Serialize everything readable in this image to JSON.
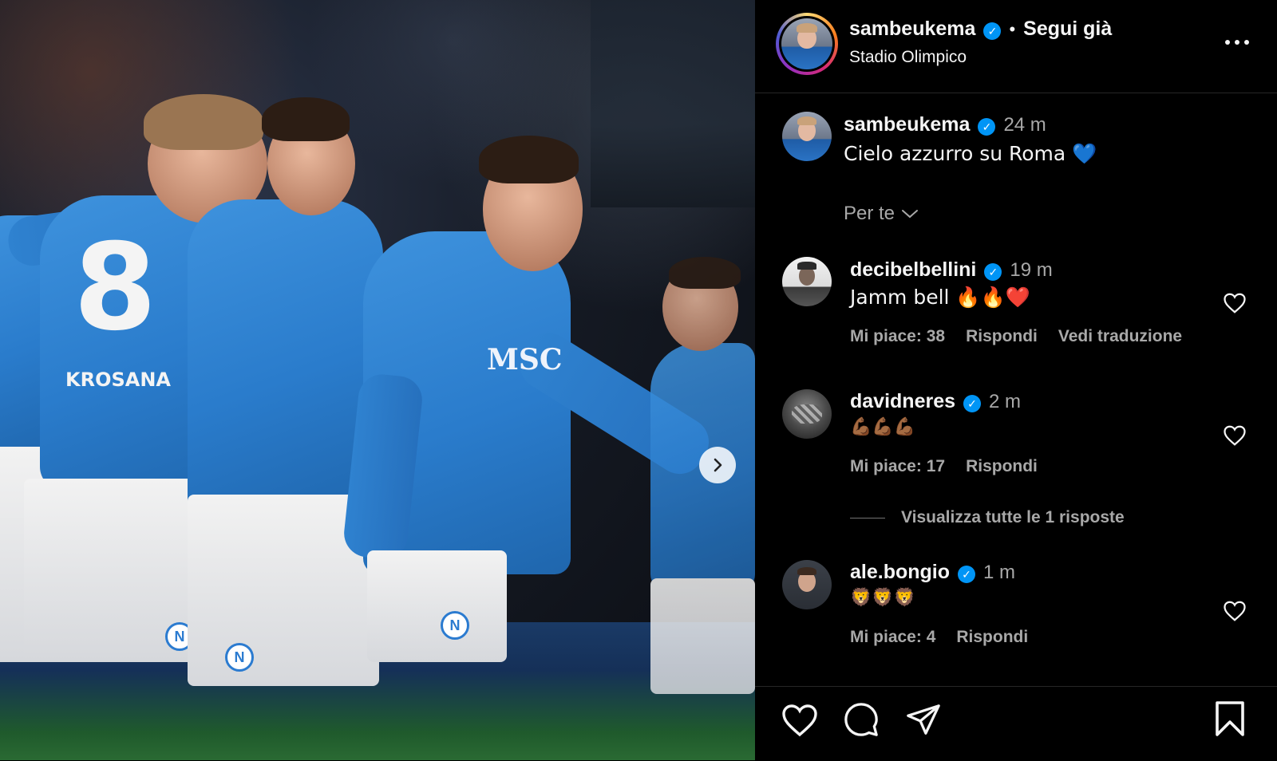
{
  "post_author": {
    "username": "sambeukema",
    "follow_status": "Segui già",
    "location": "Stadio Olimpico"
  },
  "caption": {
    "username": "sambeukema",
    "time": "24 m",
    "text": "Cielo azzurro su Roma 💙"
  },
  "filter": {
    "label": "Per te"
  },
  "photo": {
    "shirt_number": "8",
    "sponsor": "MSC",
    "back_name": "KROSANA"
  },
  "comments": [
    {
      "username": "decibelbellini",
      "time": "19 m",
      "text": "Jamm bell 🔥🔥❤️",
      "likes": "Mi piace: 38",
      "reply": "Rispondi",
      "translate": "Vedi traduzione"
    },
    {
      "username": "davidneres",
      "time": "2 m",
      "text": "💪🏾💪🏾💪🏾",
      "likes": "Mi piace: 17",
      "reply": "Rispondi",
      "view_replies": "Visualizza tutte le 1 risposte"
    },
    {
      "username": "ale.bongio",
      "time": "1 m",
      "text": "🦁🦁🦁",
      "likes": "Mi piace: 4",
      "reply": "Rispondi"
    }
  ],
  "icons": {
    "like": "heart-icon",
    "comment": "comment-icon",
    "share": "paper-plane-icon",
    "save": "bookmark-icon",
    "more": "more-horizontal-icon",
    "next": "chevron-right-icon",
    "verified": "verified-badge-icon"
  },
  "colors": {
    "background": "#000000",
    "verified": "#0095f6",
    "muted_text": "#a8a8a8",
    "jersey_blue": "#2a7ccc"
  }
}
